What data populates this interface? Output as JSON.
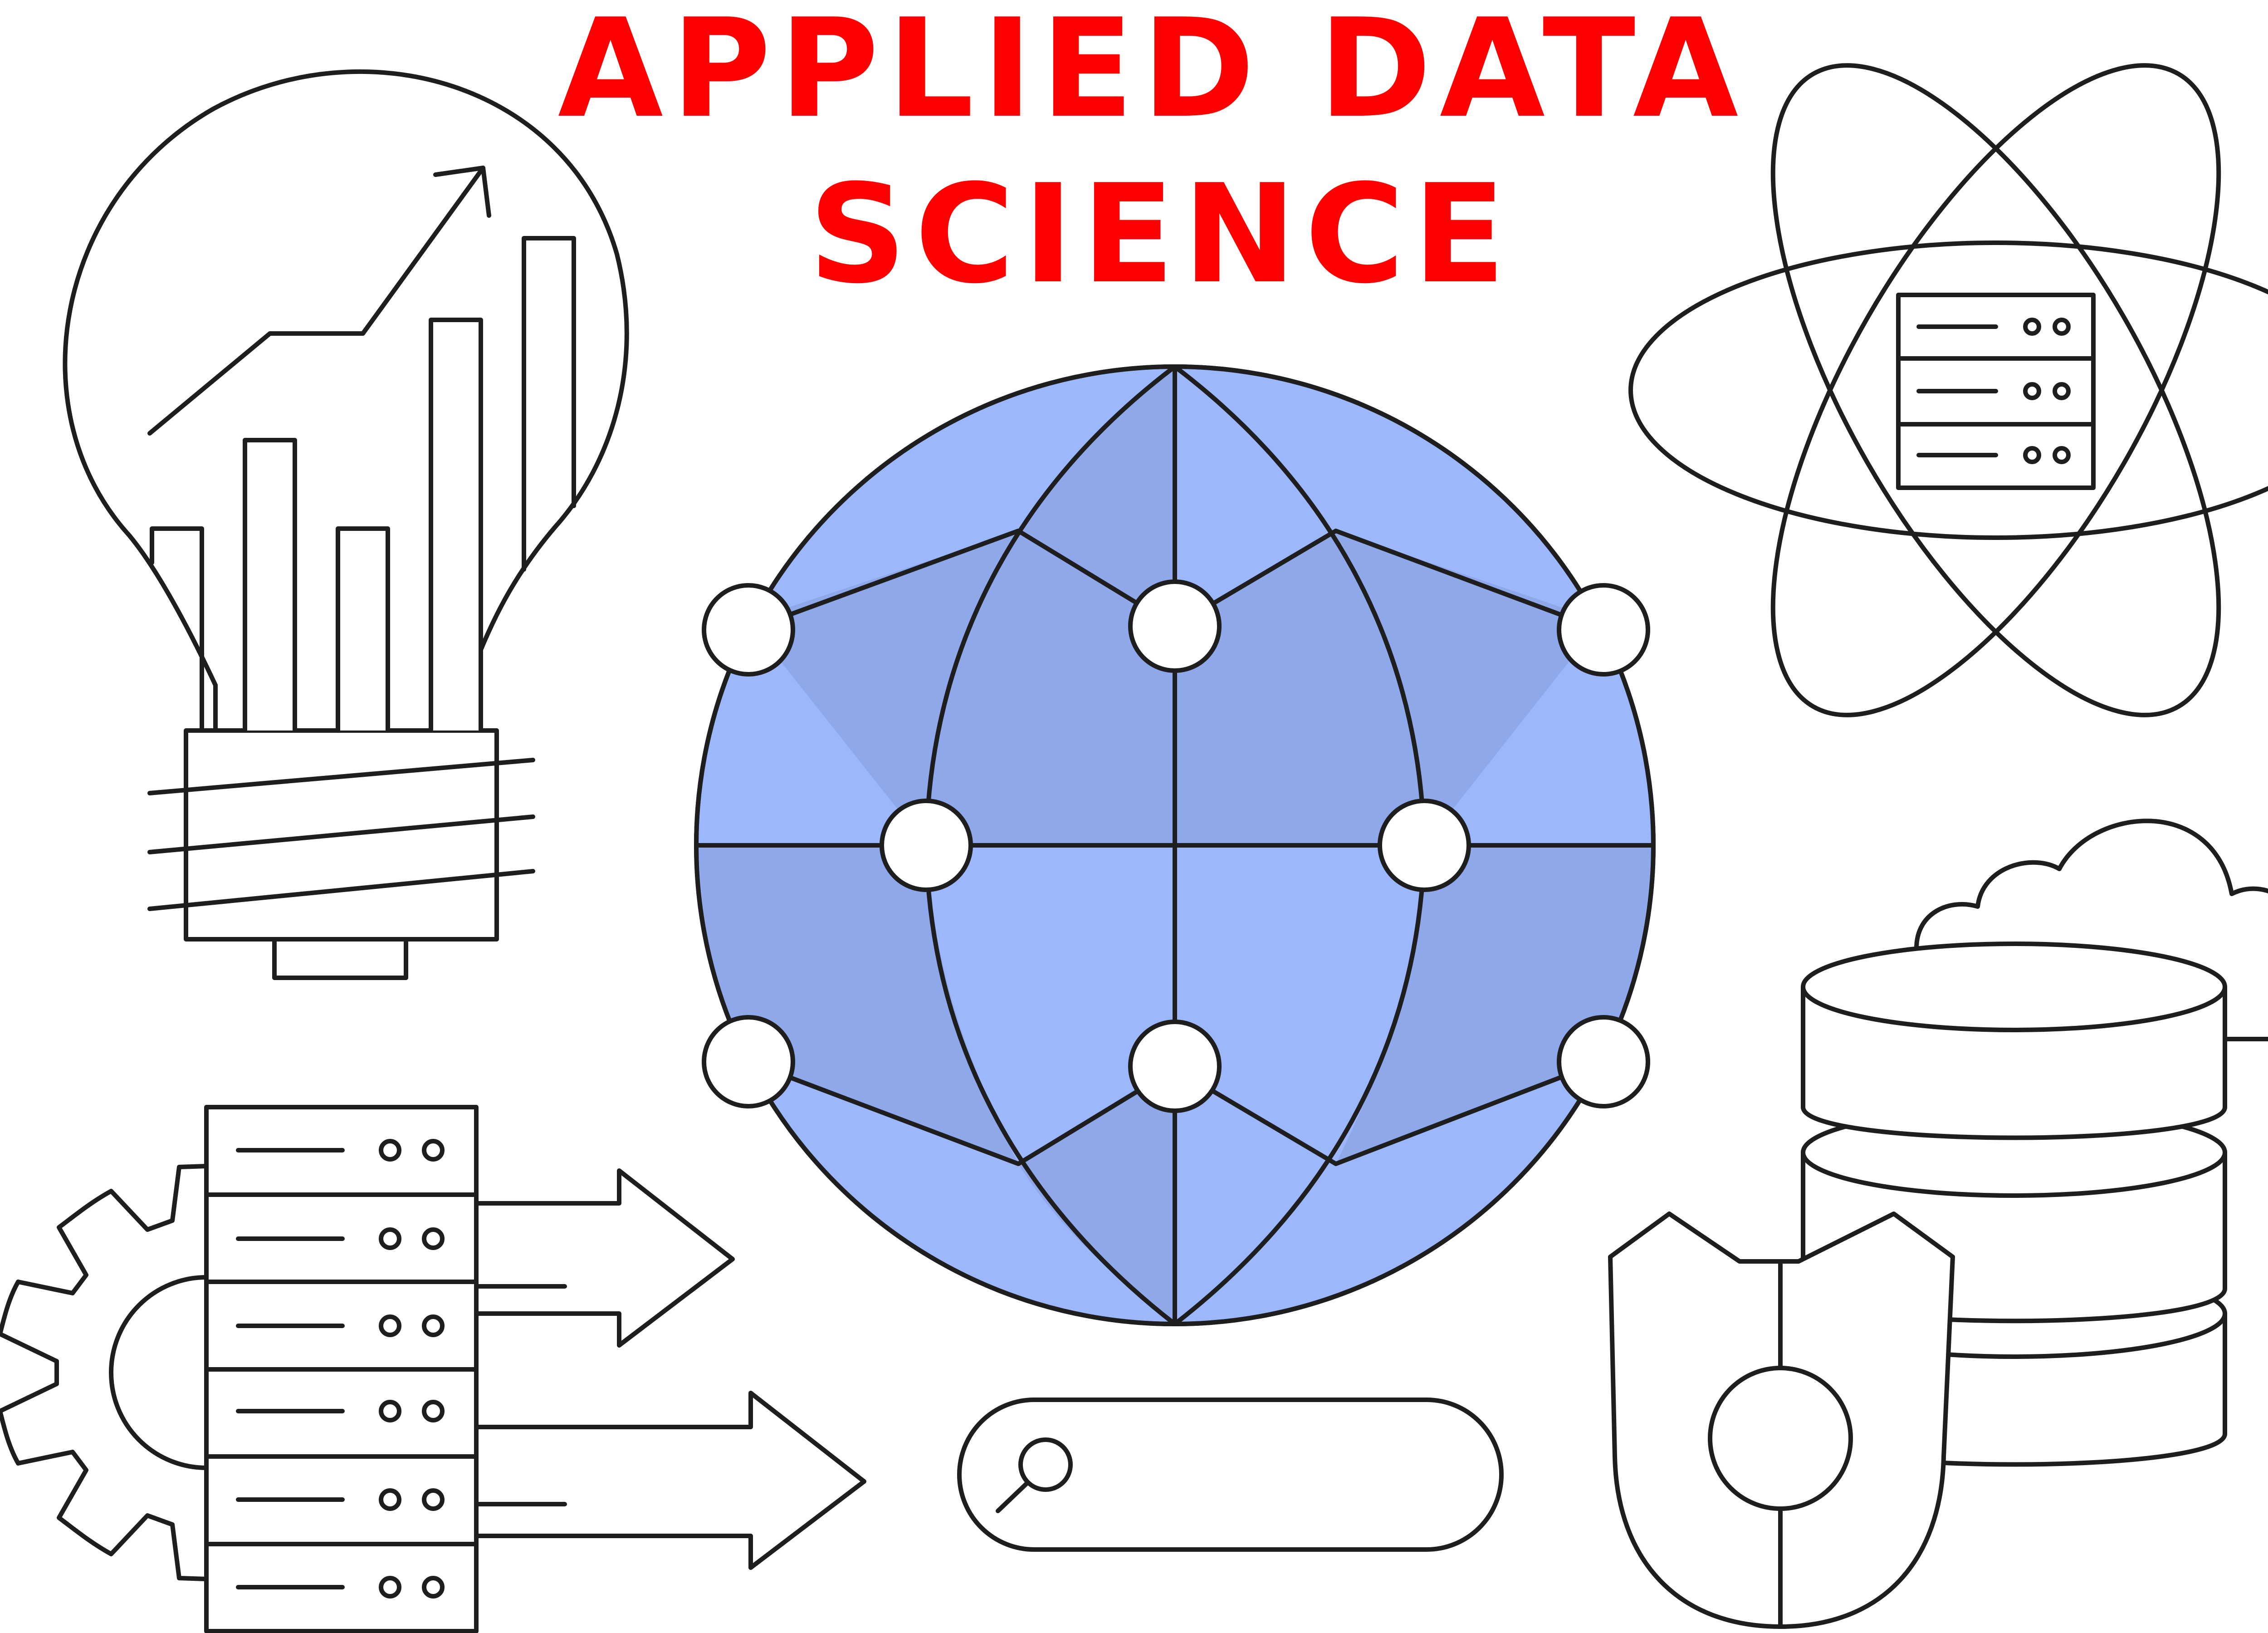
{
  "title": {
    "line1": "APPLIED DATA",
    "line2": "SCIENCE",
    "color": "#ff0000"
  },
  "palette": {
    "stroke": "#1e1e1e",
    "globe_light": "#9db7fc",
    "globe_dark": "#8fa8ea",
    "background": "#ffffff"
  },
  "icons": [
    "lightbulb-growth-chart-icon",
    "atom-server-icon",
    "network-globe-icon",
    "cloud-database-icon",
    "gear-server-rack-arrows-icon",
    "search-bar-icon",
    "shield-icon"
  ]
}
